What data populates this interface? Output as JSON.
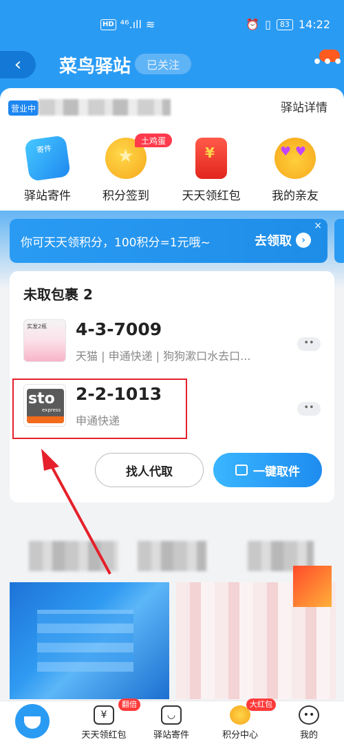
{
  "statusbar": {
    "network": "HD",
    "signal": "⁴⁶.ıll",
    "wifi": "≋",
    "alarm": "⏰",
    "vibrate": "▯",
    "battery": "83",
    "time": "14:22"
  },
  "header": {
    "back": "‹",
    "title": "菜鸟驿站",
    "follow": "已关注",
    "more": "•••"
  },
  "station": {
    "status": "营业中",
    "detail_link": "驿站详情"
  },
  "quick_actions": [
    {
      "label": "驿站寄件"
    },
    {
      "label": "积分签到",
      "badge": "土鸡蛋"
    },
    {
      "label": "天天领红包"
    },
    {
      "label": "我的亲友"
    }
  ],
  "banner": {
    "text": "你可天天领积分，100积分=1元哦~",
    "cta": "去领取",
    "cta_arrow": "›",
    "close": "×"
  },
  "parcels": {
    "title": "未取包裹 2",
    "items": [
      {
        "code": "4-3-7009",
        "desc": "天猫 | 申通快递 | 狗狗漱口水去口...",
        "thumb_text": "实发2瓶",
        "more": "••"
      },
      {
        "code": "2-2-1013",
        "desc": "申通快递",
        "logo": "sto",
        "logo_sub": "express",
        "more": "••"
      }
    ],
    "proxy_button": "找人代取",
    "pick_button": "一键取件"
  },
  "nav": [
    {
      "label": "天天领红包",
      "badge": "翻倍",
      "glyph": "¥"
    },
    {
      "label": "驿站寄件",
      "glyph": "◡"
    },
    {
      "label": "积分中心",
      "badge": "大红包"
    },
    {
      "label": "我的",
      "glyph": "••"
    }
  ],
  "colors": {
    "brand_blue": "#2a9bf3",
    "highlight_red": "#e5202a",
    "sto_orange": "#f26a1b"
  }
}
